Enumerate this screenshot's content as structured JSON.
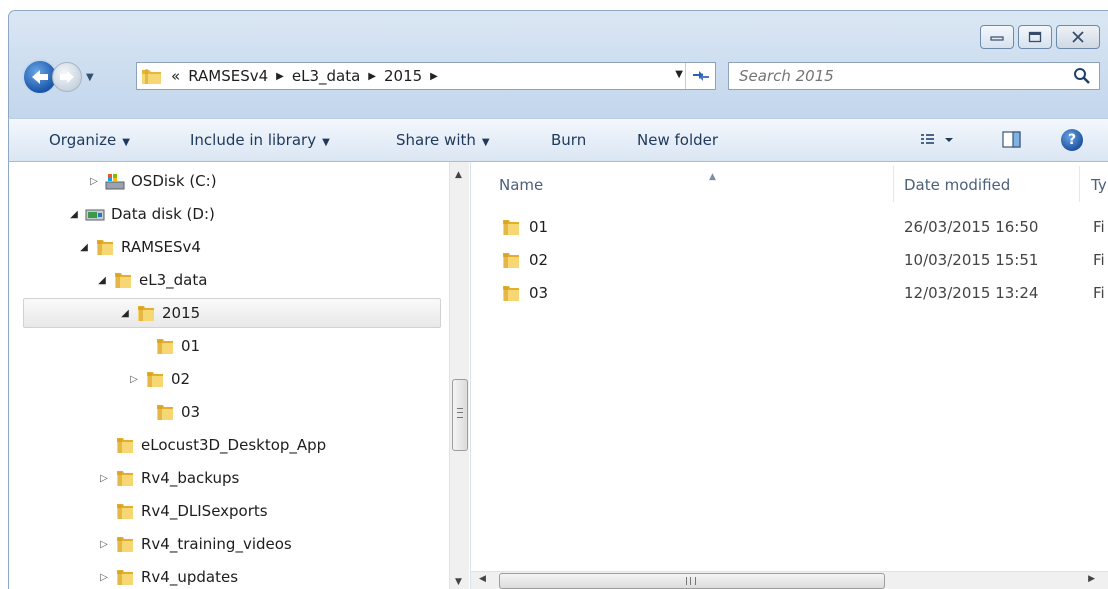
{
  "address": {
    "overflow": "«",
    "crumbs": [
      "RAMSESv4",
      "eL3_data",
      "2015"
    ]
  },
  "search": {
    "placeholder": "Search 2015"
  },
  "toolbar": {
    "organize": "Organize",
    "include_in_library": "Include in library",
    "share_with": "Share with",
    "burn": "Burn",
    "new_folder": "New folder"
  },
  "tree": [
    {
      "label": "OSDisk (C:)",
      "icon": "drive-c-icon",
      "expander": "collapsed"
    },
    {
      "label": "Data disk (D:)",
      "icon": "drive-d-icon",
      "expander": "expanded"
    },
    {
      "label": "RAMSESv4",
      "icon": "folder-icon",
      "expander": "expanded"
    },
    {
      "label": "eL3_data",
      "icon": "folder-icon",
      "expander": "expanded"
    },
    {
      "label": "2015",
      "icon": "folder-icon",
      "expander": "expanded",
      "selected": true
    },
    {
      "label": "01",
      "icon": "folder-icon",
      "expander": "none"
    },
    {
      "label": "02",
      "icon": "folder-icon",
      "expander": "collapsed"
    },
    {
      "label": "03",
      "icon": "folder-icon",
      "expander": "none"
    },
    {
      "label": "eLocust3D_Desktop_App",
      "icon": "folder-icon",
      "expander": "none"
    },
    {
      "label": "Rv4_backups",
      "icon": "folder-icon",
      "expander": "collapsed"
    },
    {
      "label": "Rv4_DLISexports",
      "icon": "folder-icon",
      "expander": "none"
    },
    {
      "label": "Rv4_training_videos",
      "icon": "folder-icon",
      "expander": "collapsed"
    },
    {
      "label": "Rv4_updates",
      "icon": "folder-icon",
      "expander": "collapsed"
    }
  ],
  "columns": {
    "name": "Name",
    "date_modified": "Date modified",
    "type": "Ty"
  },
  "files": [
    {
      "name": "01",
      "date": "26/03/2015 16:50",
      "type": "Fi"
    },
    {
      "name": "02",
      "date": "10/03/2015 15:51",
      "type": "Fi"
    },
    {
      "name": "03",
      "date": "12/03/2015 13:24",
      "type": "Fi"
    }
  ],
  "colors": {
    "folder": "#f2c94c",
    "selection": "#e8e8e8",
    "command_text": "#1e395b"
  }
}
